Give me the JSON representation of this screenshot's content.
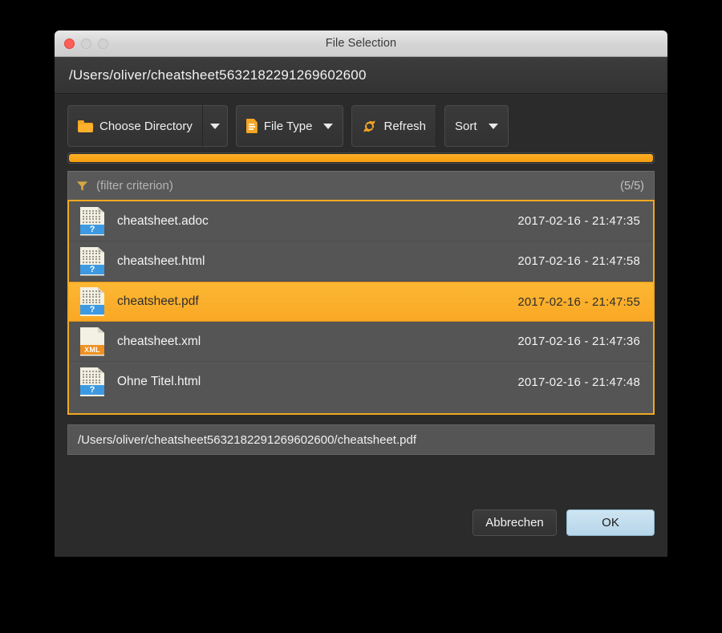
{
  "window": {
    "title": "File Selection",
    "traffic_lights": [
      "close",
      "minimize",
      "maximize"
    ],
    "current_path": "/Users/oliver/cheatsheet5632182291269602600"
  },
  "toolbar": {
    "choose_directory_label": "Choose Directory",
    "choose_directory_icon": "folder-icon",
    "choose_directory_caret": "chevron-down-icon",
    "file_type_label": "File Type",
    "file_type_icon": "document-icon",
    "file_type_caret": "chevron-down-icon",
    "refresh_label": "Refresh",
    "refresh_icon": "refresh-icon",
    "sort_label": "Sort",
    "sort_caret": "chevron-down-icon"
  },
  "progress": {
    "percent": 100,
    "accent_color": "#f6a623"
  },
  "filter": {
    "icon": "funnel-icon",
    "value": "",
    "placeholder": "(filter criterion)",
    "count": "(5/5)"
  },
  "file_list": {
    "border_color": "#f0a820",
    "selection_color": "#f9a825",
    "rows": [
      {
        "name": "cheatsheet.adoc",
        "date": "2017-02-16",
        "sep": "-",
        "time": "21:47:35",
        "icon": "generic-file-icon",
        "badge": "?",
        "badge_color": "#3d9ae2",
        "selected": false
      },
      {
        "name": "cheatsheet.html",
        "date": "2017-02-16",
        "sep": "-",
        "time": "21:47:58",
        "icon": "generic-file-icon",
        "badge": "?",
        "badge_color": "#3d9ae2",
        "selected": false
      },
      {
        "name": "cheatsheet.pdf",
        "date": "2017-02-16",
        "sep": "-",
        "time": "21:47:55",
        "icon": "generic-file-icon",
        "badge": "?",
        "badge_color": "#3d9ae2",
        "selected": true
      },
      {
        "name": "cheatsheet.xml",
        "date": "2017-02-16",
        "sep": "-",
        "time": "21:47:36",
        "icon": "xml-file-icon",
        "badge": "XML",
        "badge_color": "#ef9020",
        "glyph": "</>",
        "selected": false
      },
      {
        "name": "Ohne Titel.html",
        "date": "2017-02-16",
        "sep": "-",
        "time": "21:47:48",
        "icon": "generic-file-icon",
        "badge": "?",
        "badge_color": "#3d9ae2",
        "selected": false
      }
    ]
  },
  "selected_path": "/Users/oliver/cheatsheet5632182291269602600/cheatsheet.pdf",
  "footer": {
    "cancel_label": "Abbrechen",
    "ok_label": "OK"
  }
}
